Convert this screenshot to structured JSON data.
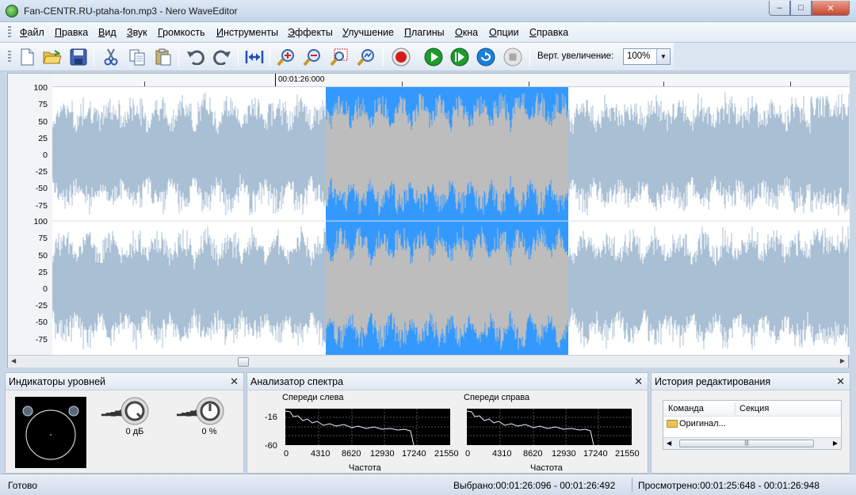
{
  "window": {
    "title": "Fan-CENTR.RU-ptaha-fon.mp3 - Nero WaveEditor",
    "minimize": "–",
    "maximize": "□",
    "close": "✕"
  },
  "menu": {
    "items": [
      "Файл",
      "Правка",
      "Вид",
      "Звук",
      "Громкость",
      "Инструменты",
      "Эффекты",
      "Улучшение",
      "Плагины",
      "Окна",
      "Опции",
      "Справка"
    ]
  },
  "toolbar": {
    "icons": [
      "new-file-icon",
      "open-folder-icon",
      "save-disk-icon",
      "cut-scissors-icon",
      "copy-icon",
      "paste-icon",
      "undo-icon",
      "redo-icon",
      "fit-width-icon",
      "zoom-in-icon",
      "zoom-out-icon",
      "zoom-selection-icon",
      "zoom-fit-icon",
      "record-icon",
      "play-icon",
      "play-selection-icon",
      "loop-icon",
      "stop-icon"
    ],
    "zoom_label": "Верт. увеличение:",
    "zoom_value": "100%"
  },
  "waveform": {
    "time_marker": "00:01:26:000",
    "axis_labels": [
      "100",
      "75",
      "50",
      "25",
      "0",
      "-25",
      "-50",
      "-75"
    ],
    "colors": {
      "background": "#ffffff",
      "wave": "#a9bfd4",
      "selection": "#3399ff",
      "wave_selected": "#bdbdbd"
    },
    "selection_start_fraction": 0.343,
    "selection_end_fraction": 0.647
  },
  "panels": {
    "levels": {
      "title": "Индикаторы уровней",
      "close": "✕",
      "volume_value": "0 дБ",
      "pan_value": "0 %"
    },
    "spectrum": {
      "title": "Анализатор спектра",
      "close": "✕",
      "left_label": "Спереди слева",
      "right_label": "Спереди справа",
      "y_ticks": [
        "-16",
        "-60"
      ],
      "x_ticks": [
        "0",
        "4310",
        "8620",
        "12930",
        "17240",
        "21550"
      ],
      "x_label": "Частота"
    },
    "history": {
      "title": "История редактирования",
      "close": "✕",
      "col_command": "Команда",
      "col_section": "Секция",
      "row_original": "Оригинал..."
    }
  },
  "status": {
    "ready": "Готово",
    "selected": "Выбрано:00:01:26:096 - 00:01:26:492",
    "viewed": "Просмотрено:00:01:25:648 - 00:01:26:948"
  }
}
